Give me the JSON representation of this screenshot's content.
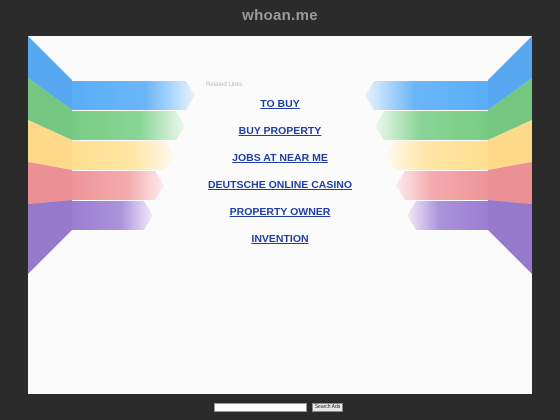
{
  "site": {
    "domain": "whoan.me"
  },
  "main": {
    "related_label": "Related Links",
    "links": [
      {
        "label": "TO BUY"
      },
      {
        "label": "BUY PROPERTY"
      },
      {
        "label": "JOBS AT NEAR ME"
      },
      {
        "label": "DEUTSCHE ONLINE CASINO"
      },
      {
        "label": "PROPERTY OWNER"
      },
      {
        "label": "INVENTION"
      }
    ]
  },
  "search": {
    "button_label": "Search Ads",
    "value": ""
  },
  "colors": {
    "ribbon_blue": "#5aaef7",
    "ribbon_green": "#7fd18b",
    "ribbon_yellow": "#ffe39a",
    "ribbon_red": "#f4a3a6",
    "ribbon_purple": "#a186d6"
  }
}
